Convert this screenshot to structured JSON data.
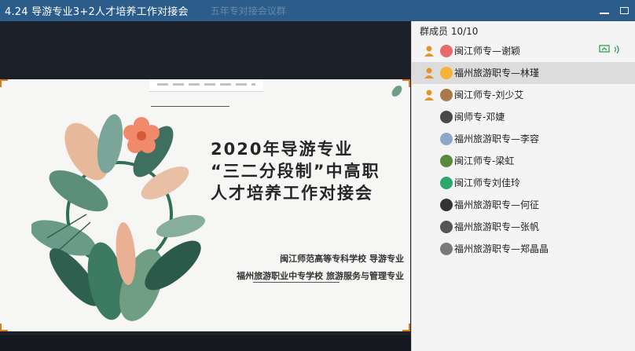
{
  "window": {
    "title": "4.24 导游专业3+2人才培养工作对接会",
    "ghost_title": "五年专对接会议群"
  },
  "slide": {
    "title_lines": [
      "2020年导游专业",
      "“三二分段制”中高职",
      "人才培养工作对接会"
    ],
    "subtitle_lines": [
      "闽江师范高等专科学校 导游专业",
      "福州旅游职业中专学校 旅游服务与管理专业"
    ]
  },
  "panel": {
    "header": "群成员 10/10",
    "members": [
      {
        "name": "闽江师专—谢颖",
        "role": "host",
        "avatar_color": "#e86a6a",
        "status": true
      },
      {
        "name": "福州旅游职专—林瑾",
        "role": "host",
        "avatar_color": "#f5b33a",
        "status": false
      },
      {
        "name": "闽江师专-刘少艾",
        "role": "host",
        "avatar_color": "#a87a4a",
        "status": false
      },
      {
        "name": "闽师专-邓婕",
        "role": "member",
        "avatar_color": "#4a4a4a",
        "status": false
      },
      {
        "name": "福州旅游职专—李容",
        "role": "member",
        "avatar_color": "#8da7c8",
        "status": false
      },
      {
        "name": "闽江师专-梁虹",
        "role": "member",
        "avatar_color": "#5a8a3a",
        "status": false
      },
      {
        "name": "闽江师专刘佳玲",
        "role": "member",
        "avatar_color": "#2aa86a",
        "status": false
      },
      {
        "name": "福州旅游职专—何征",
        "role": "member",
        "avatar_color": "#333333",
        "status": false
      },
      {
        "name": "福州旅游职专—张帆",
        "role": "member",
        "avatar_color": "#555555",
        "status": false
      },
      {
        "name": "福州旅游职专—郑晶晶",
        "role": "member",
        "avatar_color": "#7a7a7a",
        "status": false
      }
    ]
  },
  "colors": {
    "titlebar": "#2b5c8a",
    "accent_orange": "#e07a1e",
    "host_icon": "#e0962a"
  }
}
